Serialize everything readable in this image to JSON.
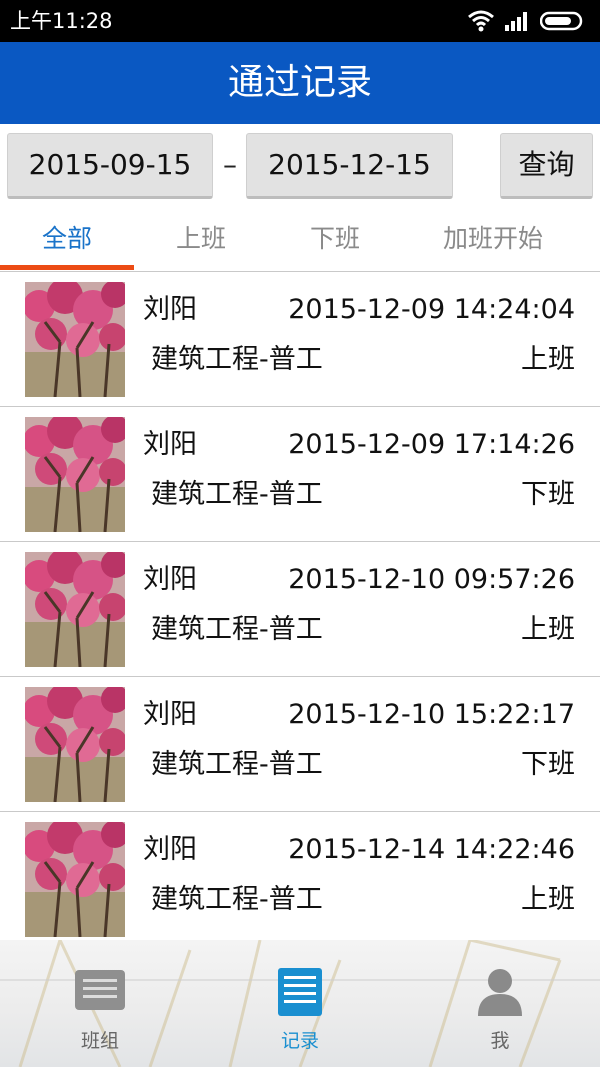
{
  "status_bar": {
    "time": "上午11:28",
    "icons": [
      "wifi-icon",
      "signal-icon",
      "battery-icon"
    ]
  },
  "header": {
    "title": "通过记录"
  },
  "query": {
    "start_date": "2015-09-15",
    "separator": "–",
    "end_date": "2015-12-15",
    "query_label": "查询"
  },
  "tabs": [
    {
      "label": "全部",
      "active": true
    },
    {
      "label": "上班",
      "active": false
    },
    {
      "label": "下班",
      "active": false
    },
    {
      "label": "加班开始",
      "active": false
    }
  ],
  "records": [
    {
      "name": "刘阳",
      "time": "2015-12-09 14:24:04",
      "job": "建筑工程-普工",
      "type": "上班"
    },
    {
      "name": "刘阳",
      "time": "2015-12-09 17:14:26",
      "job": "建筑工程-普工",
      "type": "下班"
    },
    {
      "name": "刘阳",
      "time": "2015-12-10 09:57:26",
      "job": "建筑工程-普工",
      "type": "上班"
    },
    {
      "name": "刘阳",
      "time": "2015-12-10 15:22:17",
      "job": "建筑工程-普工",
      "type": "下班"
    },
    {
      "name": "刘阳",
      "time": "2015-12-14 14:22:46",
      "job": "建筑工程-普工",
      "type": "上班"
    }
  ],
  "bottom_nav": [
    {
      "label": "班组",
      "icon": "group-list-icon",
      "active": false
    },
    {
      "label": "记录",
      "icon": "record-list-icon",
      "active": true
    },
    {
      "label": "我",
      "icon": "user-icon",
      "active": false
    }
  ],
  "colors": {
    "title_bar": "#0a58c2",
    "tab_active": "#1a73c9",
    "tab_indicator": "#ec4b14",
    "nav_active": "#1a8fd0"
  }
}
